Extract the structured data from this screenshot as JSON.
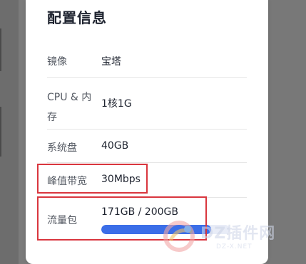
{
  "panel": {
    "title": "配置信息",
    "rows": [
      {
        "label": "镜像",
        "value": "宝塔"
      },
      {
        "label": "CPU & 内存",
        "value": "1核1G"
      },
      {
        "label": "系统盘",
        "value": "40GB"
      },
      {
        "label": "峰值带宽",
        "value": "30Mbps"
      },
      {
        "label": "流量包",
        "value": "171GB / 200GB"
      }
    ],
    "traffic_usage_fraction": 0.855
  },
  "watermark": {
    "text": "DZ插件网",
    "sub": "DZ-X.NET"
  },
  "colors": {
    "accent": "#3b6ee8",
    "highlight": "#d9363e"
  }
}
